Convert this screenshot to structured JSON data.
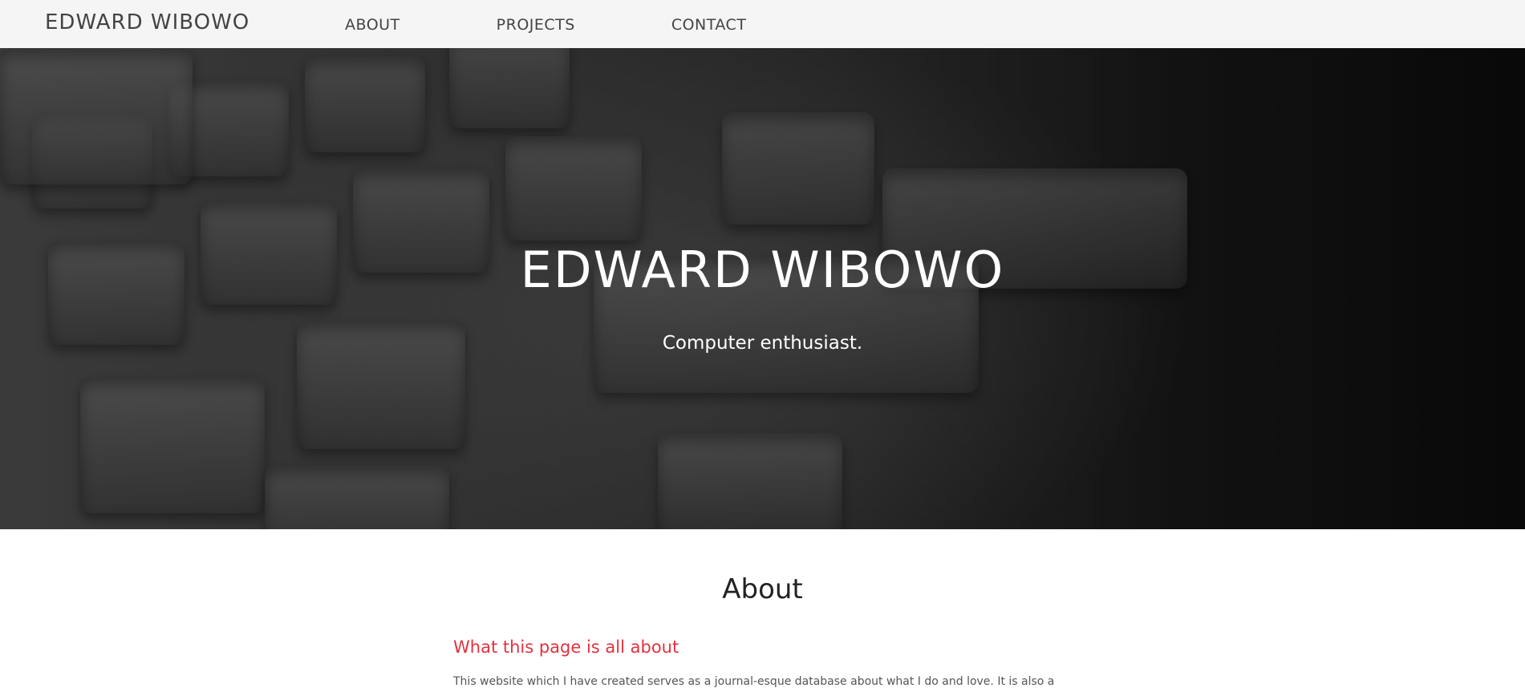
{
  "navbar": {
    "brand": "EDWARD WIBOWO",
    "links": [
      {
        "label": "ABOUT"
      },
      {
        "label": "PROJECTS"
      },
      {
        "label": "CONTACT"
      }
    ]
  },
  "hero": {
    "title": "EDWARD WIBOWO",
    "subtitle": "Computer enthusiast."
  },
  "about": {
    "heading": "About",
    "subheading": "What this page is all about",
    "body": "This website which I have created serves as a journal-esque database about what I do and love. It is also a"
  },
  "colors": {
    "navbar_bg": "#f5f5f5",
    "accent_red": "#e2323f",
    "text_dark": "#444444"
  }
}
